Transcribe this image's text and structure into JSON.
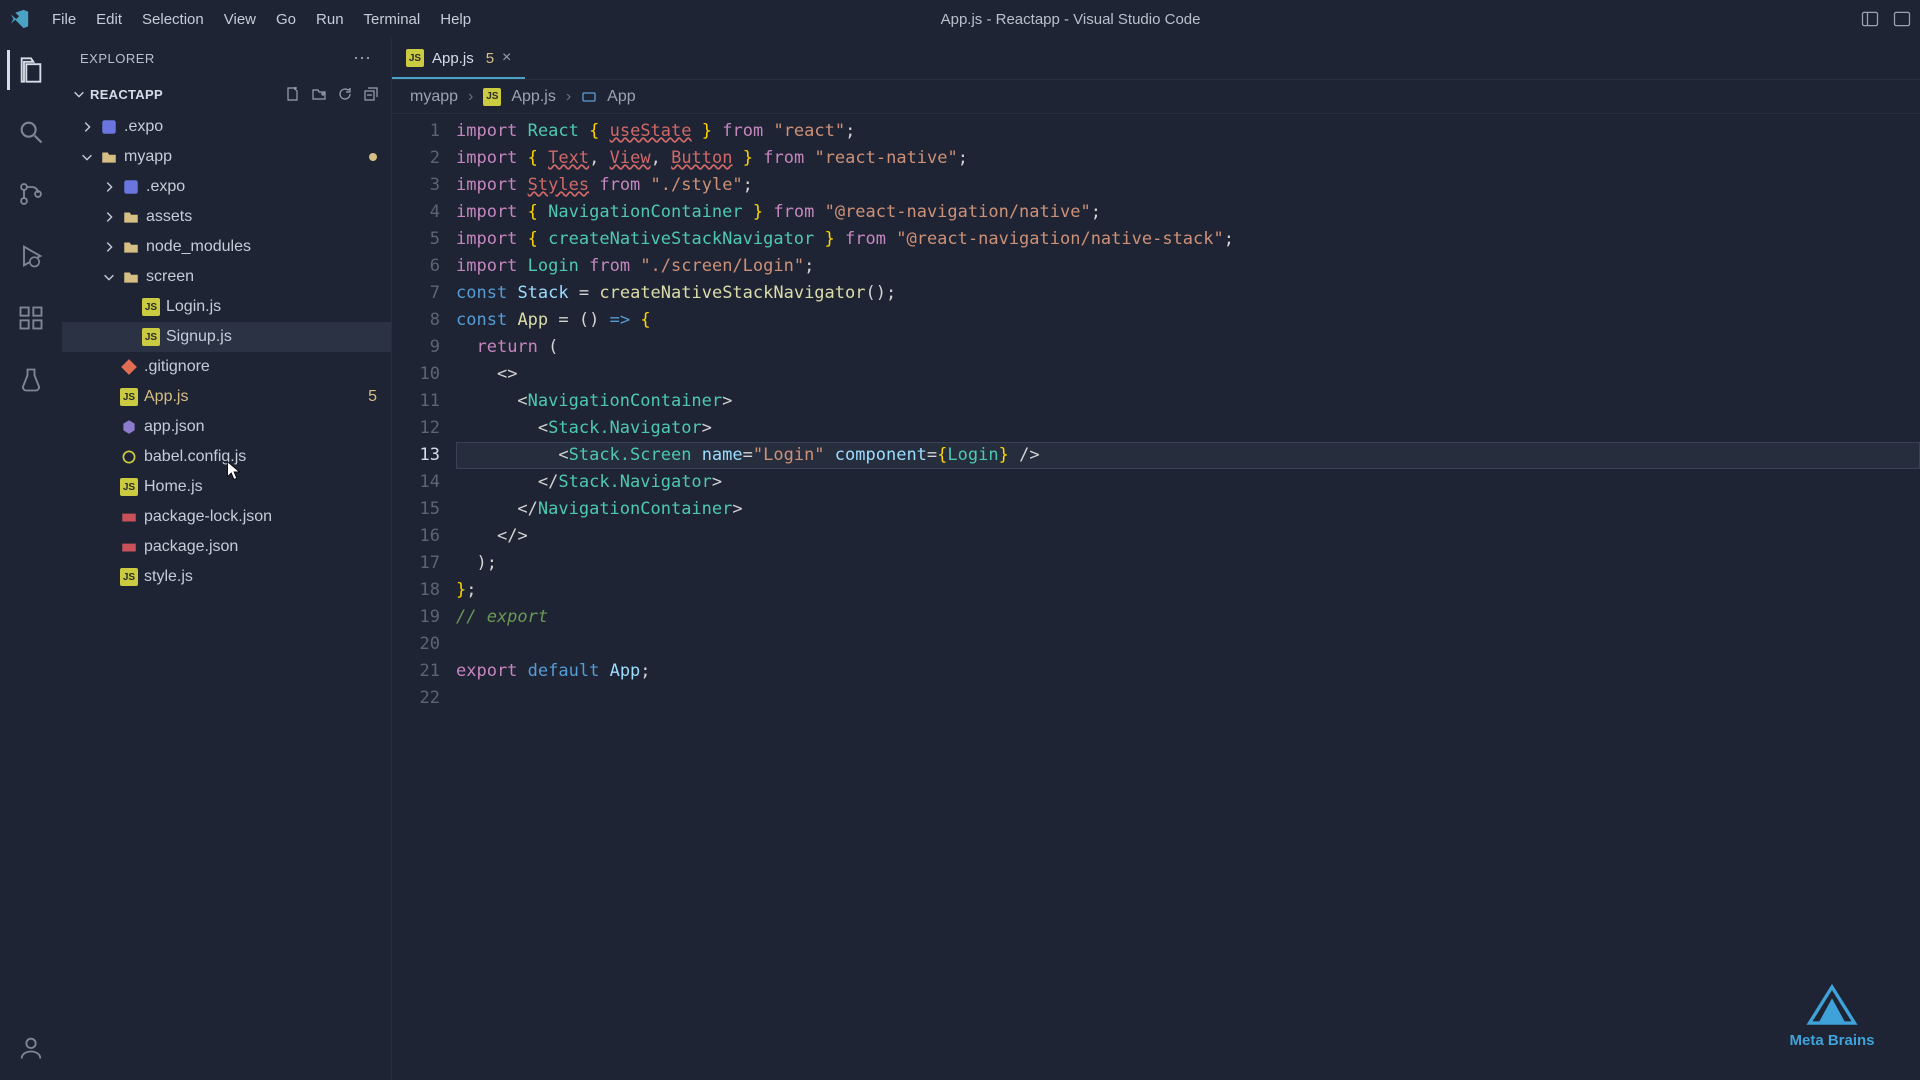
{
  "titlebar": {
    "menus": [
      "File",
      "Edit",
      "Selection",
      "View",
      "Go",
      "Run",
      "Terminal",
      "Help"
    ],
    "title": "App.js - Reactapp - Visual Studio Code"
  },
  "activitybar": {
    "items": [
      "explorer",
      "search",
      "scm",
      "debug",
      "extensions",
      "testing"
    ],
    "account": "accounts"
  },
  "sidebar": {
    "title": "EXPLORER",
    "projectName": "REACTAPP",
    "tree": [
      {
        "name": ".expo",
        "depth": 1,
        "icon": "expo",
        "chev": "right"
      },
      {
        "name": "myapp",
        "depth": 1,
        "icon": "folder",
        "chev": "down",
        "modified": true
      },
      {
        "name": ".expo",
        "depth": 2,
        "icon": "expo",
        "chev": "right"
      },
      {
        "name": "assets",
        "depth": 2,
        "icon": "folder",
        "chev": "right"
      },
      {
        "name": "node_modules",
        "depth": 2,
        "icon": "folder",
        "chev": "right"
      },
      {
        "name": "screen",
        "depth": 2,
        "icon": "folder",
        "chev": "down"
      },
      {
        "name": "Login.js",
        "depth": 3,
        "icon": "js"
      },
      {
        "name": "Signup.js",
        "depth": 3,
        "icon": "js",
        "hovered": true
      },
      {
        "name": ".gitignore",
        "depth": 2,
        "icon": "git"
      },
      {
        "name": "App.js",
        "depth": 2,
        "icon": "js",
        "selected": true,
        "badge": "5"
      },
      {
        "name": "app.json",
        "depth": 2,
        "icon": "purple"
      },
      {
        "name": "babel.config.js",
        "depth": 2,
        "icon": "json"
      },
      {
        "name": "Home.js",
        "depth": 2,
        "icon": "js"
      },
      {
        "name": "package-lock.json",
        "depth": 2,
        "icon": "npm"
      },
      {
        "name": "package.json",
        "depth": 2,
        "icon": "npm"
      },
      {
        "name": "style.js",
        "depth": 2,
        "icon": "js"
      }
    ]
  },
  "tab": {
    "icon": "js",
    "name": "App.js",
    "problems": "5"
  },
  "breadcrumb": {
    "folder": "myapp",
    "file": "App.js",
    "symbol": "App"
  },
  "code": {
    "active_line": 13,
    "lines": [
      [
        [
          "kw",
          "import"
        ],
        [
          "",
          ", "
        ],
        [
          "def",
          "React"
        ],
        [
          "",
          ", "
        ],
        [
          "brace",
          "{"
        ],
        [
          "",
          ", "
        ],
        [
          "err",
          "useState"
        ],
        [
          "",
          ", "
        ],
        [
          "brace",
          "}"
        ],
        [
          "",
          ", "
        ],
        [
          "kw",
          "from"
        ],
        [
          "",
          ", "
        ],
        [
          "str",
          "\"react\""
        ],
        [
          "punc",
          ";"
        ]
      ],
      [
        [
          "kw",
          "import"
        ],
        [
          "",
          ", "
        ],
        [
          "brace",
          "{"
        ],
        [
          "",
          ", "
        ],
        [
          "err",
          "Text"
        ],
        [
          "punc",
          ","
        ],
        [
          "",
          ", "
        ],
        [
          "err",
          "View"
        ],
        [
          "punc",
          ","
        ],
        [
          "",
          ", "
        ],
        [
          "err",
          "Button"
        ],
        [
          "",
          ", "
        ],
        [
          "brace",
          "}"
        ],
        [
          "",
          ", "
        ],
        [
          "kw",
          "from"
        ],
        [
          "",
          ", "
        ],
        [
          "str",
          "\"react-native\""
        ],
        [
          "punc",
          ";"
        ]
      ],
      [
        [
          "kw",
          "import"
        ],
        [
          "",
          ", "
        ],
        [
          "err",
          "Styles"
        ],
        [
          "",
          ", "
        ],
        [
          "kw",
          "from"
        ],
        [
          "",
          ", "
        ],
        [
          "str",
          "\"./style\""
        ],
        [
          "punc",
          ";"
        ]
      ],
      [
        [
          "kw",
          "import"
        ],
        [
          "",
          ", "
        ],
        [
          "brace",
          "{"
        ],
        [
          "",
          ", "
        ],
        [
          "def",
          "NavigationContainer"
        ],
        [
          "",
          ", "
        ],
        [
          "brace",
          "}"
        ],
        [
          "",
          ", "
        ],
        [
          "kw",
          "from"
        ],
        [
          "",
          ", "
        ],
        [
          "str",
          "\"@react-navigation/native\""
        ],
        [
          "punc",
          ";"
        ]
      ],
      [
        [
          "kw",
          "import"
        ],
        [
          "",
          ", "
        ],
        [
          "brace",
          "{"
        ],
        [
          "",
          ", "
        ],
        [
          "def",
          "createNativeStackNavigator"
        ],
        [
          "",
          ", "
        ],
        [
          "brace",
          "}"
        ],
        [
          "",
          ", "
        ],
        [
          "kw",
          "from"
        ],
        [
          "",
          ", "
        ],
        [
          "str",
          "\"@react-navigation/native-stack\""
        ],
        [
          "punc",
          ";"
        ]
      ],
      [
        [
          "kw",
          "import"
        ],
        [
          "",
          ", "
        ],
        [
          "def",
          "Login"
        ],
        [
          "",
          ", "
        ],
        [
          "kw",
          "from"
        ],
        [
          "",
          ", "
        ],
        [
          "str",
          "\"./screen/Login\""
        ],
        [
          "punc",
          ";"
        ]
      ],
      [
        [
          "const",
          "const"
        ],
        [
          "",
          ", "
        ],
        [
          "obj",
          "Stack"
        ],
        [
          "",
          ", "
        ],
        [
          "punc",
          "="
        ],
        [
          "",
          ", "
        ],
        [
          "fn",
          "createNativeStackNavigator"
        ],
        [
          "punc",
          "();"
        ]
      ],
      [
        [
          "const",
          "const"
        ],
        [
          "",
          ", "
        ],
        [
          "fn",
          "App"
        ],
        [
          "",
          ", "
        ],
        [
          "punc",
          "="
        ],
        [
          "",
          ", "
        ],
        [
          "punc",
          "()"
        ],
        [
          "",
          ", "
        ],
        [
          "const",
          "=>"
        ],
        [
          "",
          ", "
        ],
        [
          "brace",
          "{"
        ]
      ],
      [
        [
          "",
          "  "
        ],
        [
          "kw",
          "return"
        ],
        [
          "",
          ", "
        ],
        [
          "punc",
          "("
        ]
      ],
      [
        [
          "",
          "    "
        ],
        [
          "punc",
          "<"
        ],
        [
          "punc",
          ">"
        ]
      ],
      [
        [
          "",
          "      "
        ],
        [
          "punc",
          "<"
        ],
        [
          "comp",
          "NavigationContainer"
        ],
        [
          "punc",
          ">"
        ]
      ],
      [
        [
          "",
          "        "
        ],
        [
          "punc",
          "<"
        ],
        [
          "comp",
          "Stack.Navigator"
        ],
        [
          "punc",
          ">"
        ]
      ],
      [
        [
          "",
          "          "
        ],
        [
          "punc",
          "<"
        ],
        [
          "comp",
          "Stack.Screen"
        ],
        [
          "",
          ", "
        ],
        [
          "attr",
          "name"
        ],
        [
          "punc",
          "="
        ],
        [
          "str",
          "\"Login\""
        ],
        [
          "",
          ", "
        ],
        [
          "attr",
          "component"
        ],
        [
          "punc",
          "="
        ],
        [
          "brace",
          "{"
        ],
        [
          "def",
          "Login"
        ],
        [
          "brace",
          "}"
        ],
        [
          "",
          ", "
        ],
        [
          "punc",
          "/>"
        ]
      ],
      [
        [
          "",
          "        "
        ],
        [
          "punc",
          "</"
        ],
        [
          "comp",
          "Stack.Navigator"
        ],
        [
          "punc",
          ">"
        ]
      ],
      [
        [
          "",
          "      "
        ],
        [
          "punc",
          "</"
        ],
        [
          "comp",
          "NavigationContainer"
        ],
        [
          "punc",
          ">"
        ]
      ],
      [
        [
          "",
          "    "
        ],
        [
          "punc",
          "</"
        ],
        [
          "punc",
          ">"
        ]
      ],
      [
        [
          "",
          "  "
        ],
        [
          "punc",
          ");"
        ]
      ],
      [
        [
          "brace",
          "}"
        ],
        [
          "punc",
          ";"
        ]
      ],
      [
        [
          "comment",
          "// export"
        ]
      ],
      [
        [
          "",
          ""
        ]
      ],
      [
        [
          "kw",
          "export"
        ],
        [
          "",
          ", "
        ],
        [
          "const",
          "default"
        ],
        [
          "",
          ", "
        ],
        [
          "obj",
          "App"
        ],
        [
          "punc",
          ";"
        ]
      ],
      [
        [
          "",
          ""
        ]
      ]
    ]
  },
  "brand": "Meta Brains"
}
